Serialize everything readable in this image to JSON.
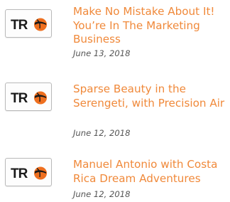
{
  "logo": {
    "text": "TRO",
    "accent_color": "#ee6f1f",
    "text_color": "#1a1a1a"
  },
  "title_color": "#f0893a",
  "date_color": "#555555",
  "posts": [
    {
      "title": "Make No Mistake About It! You’re In The Marketing Business",
      "date": "June 13, 2018"
    },
    {
      "title": "Sparse Beauty in the Serengeti, with Precision Air",
      "date": "June 12, 2018"
    },
    {
      "title": "Manuel Antonio with Costa Rica Dream Adventures",
      "date": "June 12, 2018"
    }
  ]
}
